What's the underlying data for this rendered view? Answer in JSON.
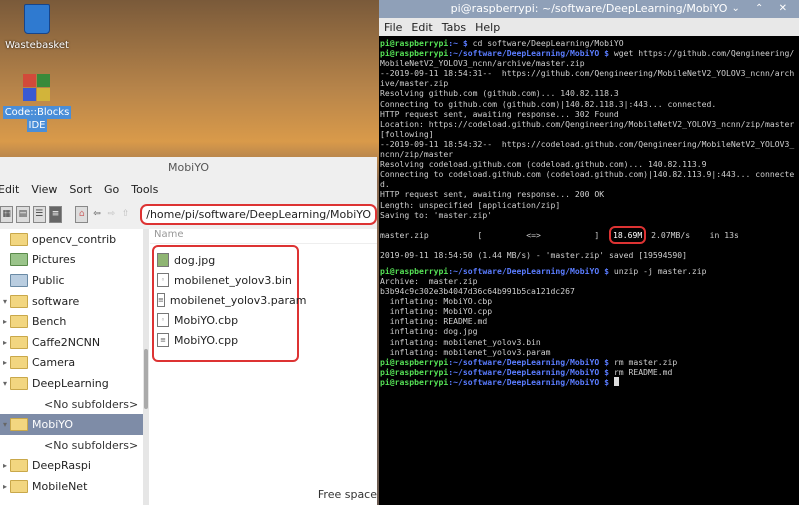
{
  "desktop": {
    "wastebasket": "Wastebasket",
    "codeblocks_line1": "Code::Blocks",
    "codeblocks_line2": "IDE"
  },
  "file_manager": {
    "title": "MobiYO",
    "menu": [
      "Edit",
      "View",
      "Sort",
      "Go",
      "Tools"
    ],
    "path": "/home/pi/software/DeepLearning/MobiYO",
    "tree": [
      {
        "label": "opencv_contrib",
        "arrow": "",
        "type": "folder"
      },
      {
        "label": "Pictures",
        "arrow": "",
        "type": "green"
      },
      {
        "label": "Public",
        "arrow": "",
        "type": "blue"
      },
      {
        "label": "software",
        "arrow": "▾",
        "type": "folder"
      },
      {
        "label": "Bench",
        "arrow": "▸",
        "type": "folder"
      },
      {
        "label": "Caffe2NCNN",
        "arrow": "▸",
        "type": "folder"
      },
      {
        "label": "Camera",
        "arrow": "▸",
        "type": "folder"
      },
      {
        "label": "DeepLearning",
        "arrow": "▾",
        "type": "folder"
      },
      {
        "label": "<No subfolders>",
        "arrow": "",
        "type": "nosub"
      },
      {
        "label": "MobiYO",
        "arrow": "▾",
        "type": "folder",
        "selected": true
      },
      {
        "label": "<No subfolders>",
        "arrow": "",
        "type": "nosub"
      },
      {
        "label": "DeepRaspi",
        "arrow": "▸",
        "type": "folder"
      },
      {
        "label": "MobileNet",
        "arrow": "▸",
        "type": "folder"
      }
    ],
    "column_name": "Name",
    "files": [
      {
        "name": "dog.jpg",
        "icon": "image-file-icon"
      },
      {
        "name": "mobilenet_yolov3.bin",
        "icon": "binary-file-icon"
      },
      {
        "name": "mobilenet_yolov3.param",
        "icon": "text-file-icon"
      },
      {
        "name": "MobiYO.cbp",
        "icon": "binary-file-icon"
      },
      {
        "name": "MobiYO.cpp",
        "icon": "text-file-icon"
      }
    ],
    "free_space": "Free space"
  },
  "terminal": {
    "title": "pi@raspberrypi: ~/software/DeepLearning/MobiYO",
    "window_controls": "⌄ ⌃ ✕",
    "menu": [
      "File",
      "Edit",
      "Tabs",
      "Help"
    ],
    "prompt_user": "pi@raspberrypi",
    "lines": [
      {
        "kind": "cmd",
        "path": ":~ $",
        "cmd": " cd software/DeepLearning/MobiYO"
      },
      {
        "kind": "cmd",
        "path": ":~/software/DeepLearning/MobiYO $",
        "cmd": " wget https://github.com/Qengineering/MobileNetV2_YOLOV3_ncnn/archive/master.zip"
      },
      {
        "kind": "text",
        "text": "--2019-09-11 18:54:31--  https://github.com/Qengineering/MobileNetV2_YOLOV3_ncnn/archive/master.zip"
      },
      {
        "kind": "text",
        "text": "Resolving github.com (github.com)... 140.82.118.3"
      },
      {
        "kind": "text",
        "text": "Connecting to github.com (github.com)|140.82.118.3|:443... connected."
      },
      {
        "kind": "text",
        "text": "HTTP request sent, awaiting response... 302 Found"
      },
      {
        "kind": "text",
        "text": "Location: https://codeload.github.com/Qengineering/MobileNetV2_YOLOV3_ncnn/zip/master [following]"
      },
      {
        "kind": "text",
        "text": "--2019-09-11 18:54:32--  https://codeload.github.com/Qengineering/MobileNetV2_YOLOV3_ncnn/zip/master"
      },
      {
        "kind": "text",
        "text": "Resolving codeload.github.com (codeload.github.com)... 140.82.113.9"
      },
      {
        "kind": "text",
        "text": "Connecting to codeload.github.com (codeload.github.com)|140.82.113.9|:443... connected."
      },
      {
        "kind": "text",
        "text": "HTTP request sent, awaiting response... 200 OK"
      },
      {
        "kind": "text",
        "text": "Length: unspecified [application/zip]"
      },
      {
        "kind": "text",
        "text": "Saving to: 'master.zip'"
      },
      {
        "kind": "blank"
      },
      {
        "kind": "progress",
        "file": "master.zip",
        "bar": "[         <=>           ]",
        "size": "18.69M",
        "rate": "2.07MB/s",
        "time": "in 13s"
      },
      {
        "kind": "blank"
      },
      {
        "kind": "text",
        "text": "2019-09-11 18:54:50 (1.44 MB/s) - 'master.zip' saved [19594590]"
      },
      {
        "kind": "blank"
      },
      {
        "kind": "cmd",
        "path": ":~/software/DeepLearning/MobiYO $",
        "cmd": " unzip -j master.zip"
      },
      {
        "kind": "text",
        "text": "Archive:  master.zip"
      },
      {
        "kind": "text",
        "text": "b3b94c9c302e3b4047d36c64b991b5ca121dc267"
      },
      {
        "kind": "text",
        "text": "  inflating: MobiYO.cbp"
      },
      {
        "kind": "text",
        "text": "  inflating: MobiYO.cpp"
      },
      {
        "kind": "text",
        "text": "  inflating: README.md"
      },
      {
        "kind": "text",
        "text": "  inflating: dog.jpg"
      },
      {
        "kind": "text",
        "text": "  inflating: mobilenet_yolov3.bin"
      },
      {
        "kind": "text",
        "text": "  inflating: mobilenet_yolov3.param"
      },
      {
        "kind": "cmd",
        "path": ":~/software/DeepLearning/MobiYO $",
        "cmd": " rm master.zip"
      },
      {
        "kind": "cmd",
        "path": ":~/software/DeepLearning/MobiYO $",
        "cmd": " rm README.md"
      },
      {
        "kind": "cmd",
        "path": ":~/software/DeepLearning/MobiYO $",
        "cmd": " ",
        "cursor": true
      }
    ]
  }
}
